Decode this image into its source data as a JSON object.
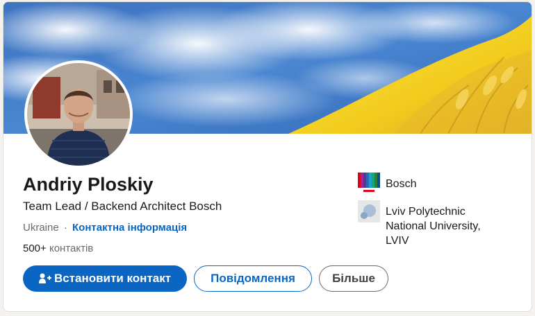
{
  "profile": {
    "name": "Andriy Ploskiy",
    "headline": "Team Lead / Backend Architect Bosch",
    "location": "Ukraine",
    "separator": "·",
    "contact_info_link": "Контактна інформація",
    "connections_count": "500+",
    "connections_label": "контактів"
  },
  "actions": {
    "connect_label": "Встановити контакт",
    "message_label": "Повідомлення",
    "more_label": "Більше"
  },
  "organizations": [
    {
      "label": "Bosch",
      "icon": "bosch-logo"
    },
    {
      "label": "Lviv Polytechnic National University, LVIV",
      "icon": "lviv-polytechnic-logo"
    }
  ],
  "colors": {
    "accent": "#0a66c2",
    "flag_blue": "#2f6fc6",
    "flag_yellow": "#f5d21a"
  }
}
